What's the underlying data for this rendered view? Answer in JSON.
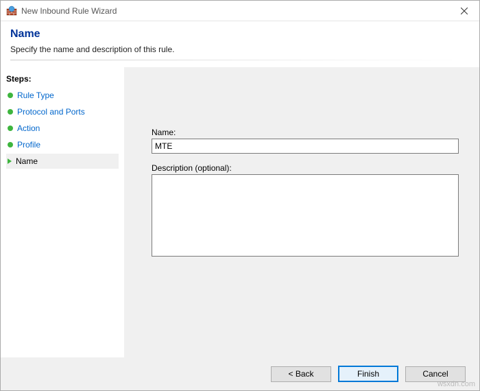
{
  "window": {
    "title": "New Inbound Rule Wizard"
  },
  "header": {
    "title": "Name",
    "subtitle": "Specify the name and description of this rule."
  },
  "sidebar": {
    "label": "Steps:",
    "items": [
      {
        "label": "Rule Type"
      },
      {
        "label": "Protocol and Ports"
      },
      {
        "label": "Action"
      },
      {
        "label": "Profile"
      },
      {
        "label": "Name"
      }
    ]
  },
  "form": {
    "name_label": "Name:",
    "name_value": "MTE",
    "description_label": "Description (optional):",
    "description_value": ""
  },
  "buttons": {
    "back": "< Back",
    "finish": "Finish",
    "cancel": "Cancel"
  },
  "watermark": "wsxdn.com"
}
